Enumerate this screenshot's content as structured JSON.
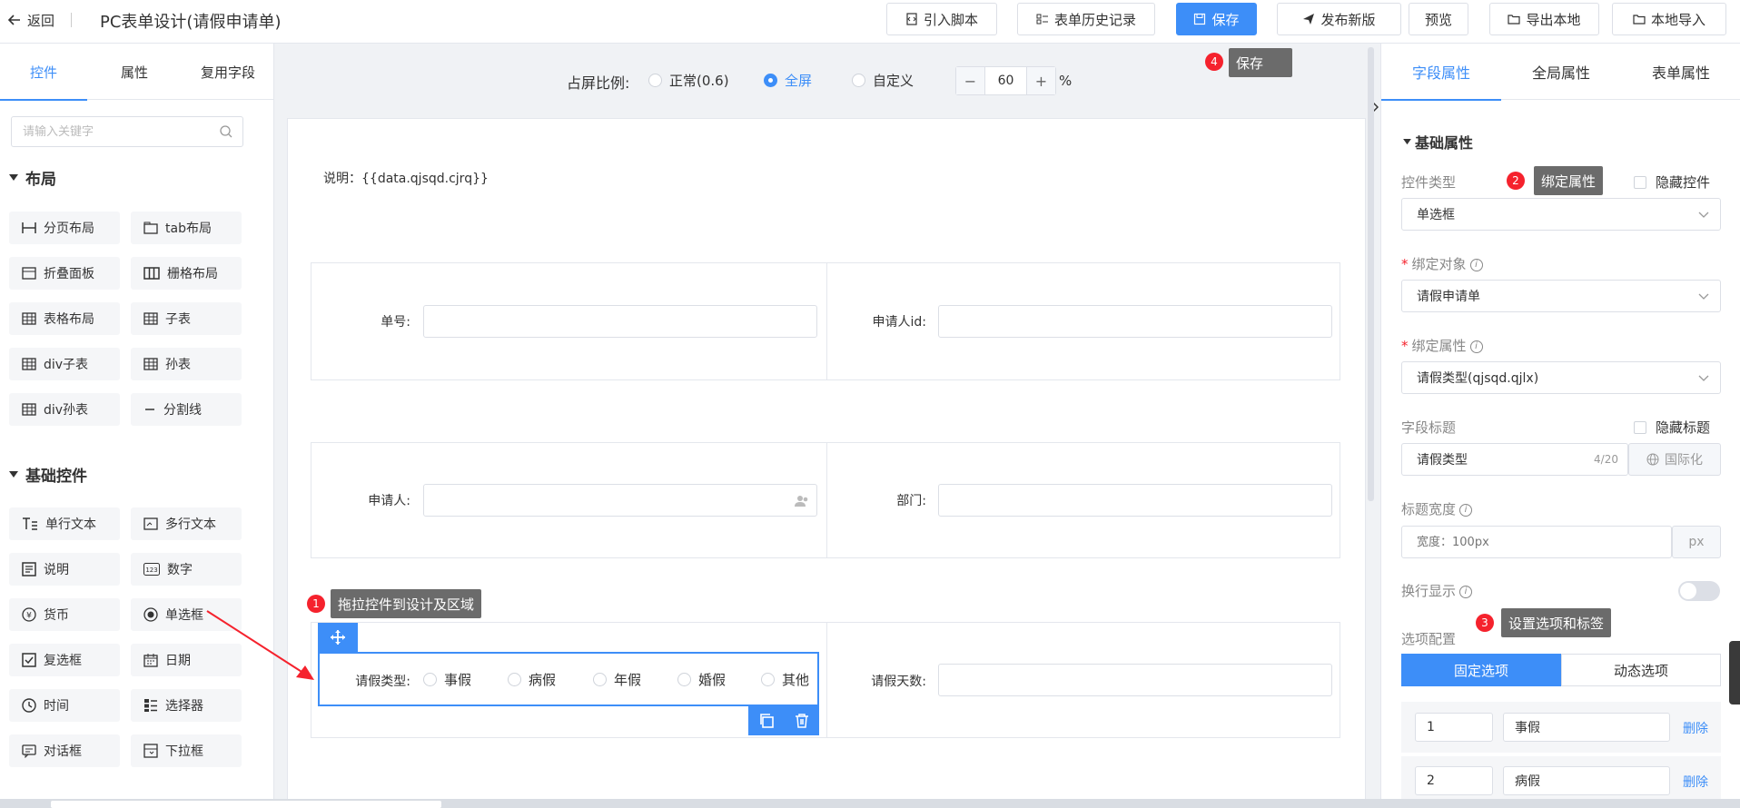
{
  "header": {
    "back_label": "返回",
    "title": "PC表单设计(请假申请单)",
    "buttons": {
      "import_script": "引入脚本",
      "history": "表单历史记录",
      "save": "保存",
      "publish": "发布新版",
      "preview": "预览",
      "export": "导出本地",
      "import": "本地导入"
    }
  },
  "left_panel": {
    "tabs": [
      "控件",
      "属性",
      "复用字段"
    ],
    "search_placeholder": "请输入关键字",
    "layout_group": {
      "title": "布局",
      "items": [
        "分页布局",
        "tab布局",
        "折叠面板",
        "栅格布局",
        "表格布局",
        "子表",
        "div子表",
        "孙表",
        "div孙表",
        "分割线"
      ]
    },
    "basic_group": {
      "title": "基础控件",
      "items": [
        "单行文本",
        "多行文本",
        "说明",
        "数字",
        "货币",
        "单选框",
        "复选框",
        "日期",
        "时间",
        "选择器",
        "对话框",
        "下拉框"
      ]
    }
  },
  "canvas": {
    "ratio_label": "占屏比例:",
    "ratio_options": [
      "正常(0.6)",
      "全屏",
      "自定义"
    ],
    "ratio_selected": "全屏",
    "zoom_value": "60",
    "zoom_unit": "%",
    "note": "说明：{{data.qjsqd.cjrq}}",
    "fields": {
      "number": "单号:",
      "applicant_id": "申请人id:",
      "applicant": "申请人:",
      "department": "部门:",
      "leave_type": "请假类型:",
      "leave_days": "请假天数:"
    },
    "leave_options": [
      "事假",
      "病假",
      "年假",
      "婚假",
      "其他"
    ]
  },
  "tooltips": {
    "drag": {
      "num": "1",
      "text": "拖拉控件到设计及区域"
    },
    "bind": {
      "num": "2",
      "text": "绑定属性"
    },
    "options": {
      "num": "3",
      "text": "设置选项和标签"
    },
    "save": {
      "num": "4",
      "text": "保存"
    }
  },
  "right_panel": {
    "tabs": [
      "字段属性",
      "全局属性",
      "表单属性"
    ],
    "section_title": "基础属性",
    "control_type_label": "控件类型",
    "control_type_value": "单选框",
    "hide_control_label": "隐藏控件",
    "bind_object_label": "绑定对象",
    "bind_object_value": "请假申请单",
    "bind_attr_label": "绑定属性",
    "bind_attr_value": "请假类型(qjsqd.qjlx)",
    "field_title_label": "字段标题",
    "hide_title_label": "隐藏标题",
    "field_title_value": "请假类型",
    "field_title_count": "4/20",
    "i18n_label": "国际化",
    "title_width_label": "标题宽度",
    "title_width_placeholder": "宽度：100px",
    "title_width_unit": "px",
    "wrap_label": "换行显示",
    "options_config_label": "选项配置",
    "fixed_options": "固定选项",
    "dynamic_options": "动态选项",
    "option_rows": [
      {
        "value": "1",
        "label": "事假"
      },
      {
        "value": "2",
        "label": "病假"
      }
    ],
    "delete_label": "删除"
  },
  "colors": {
    "primary": "#3d8ef8",
    "badge": "#f5222d",
    "tooltip": "#6b6b6b"
  }
}
